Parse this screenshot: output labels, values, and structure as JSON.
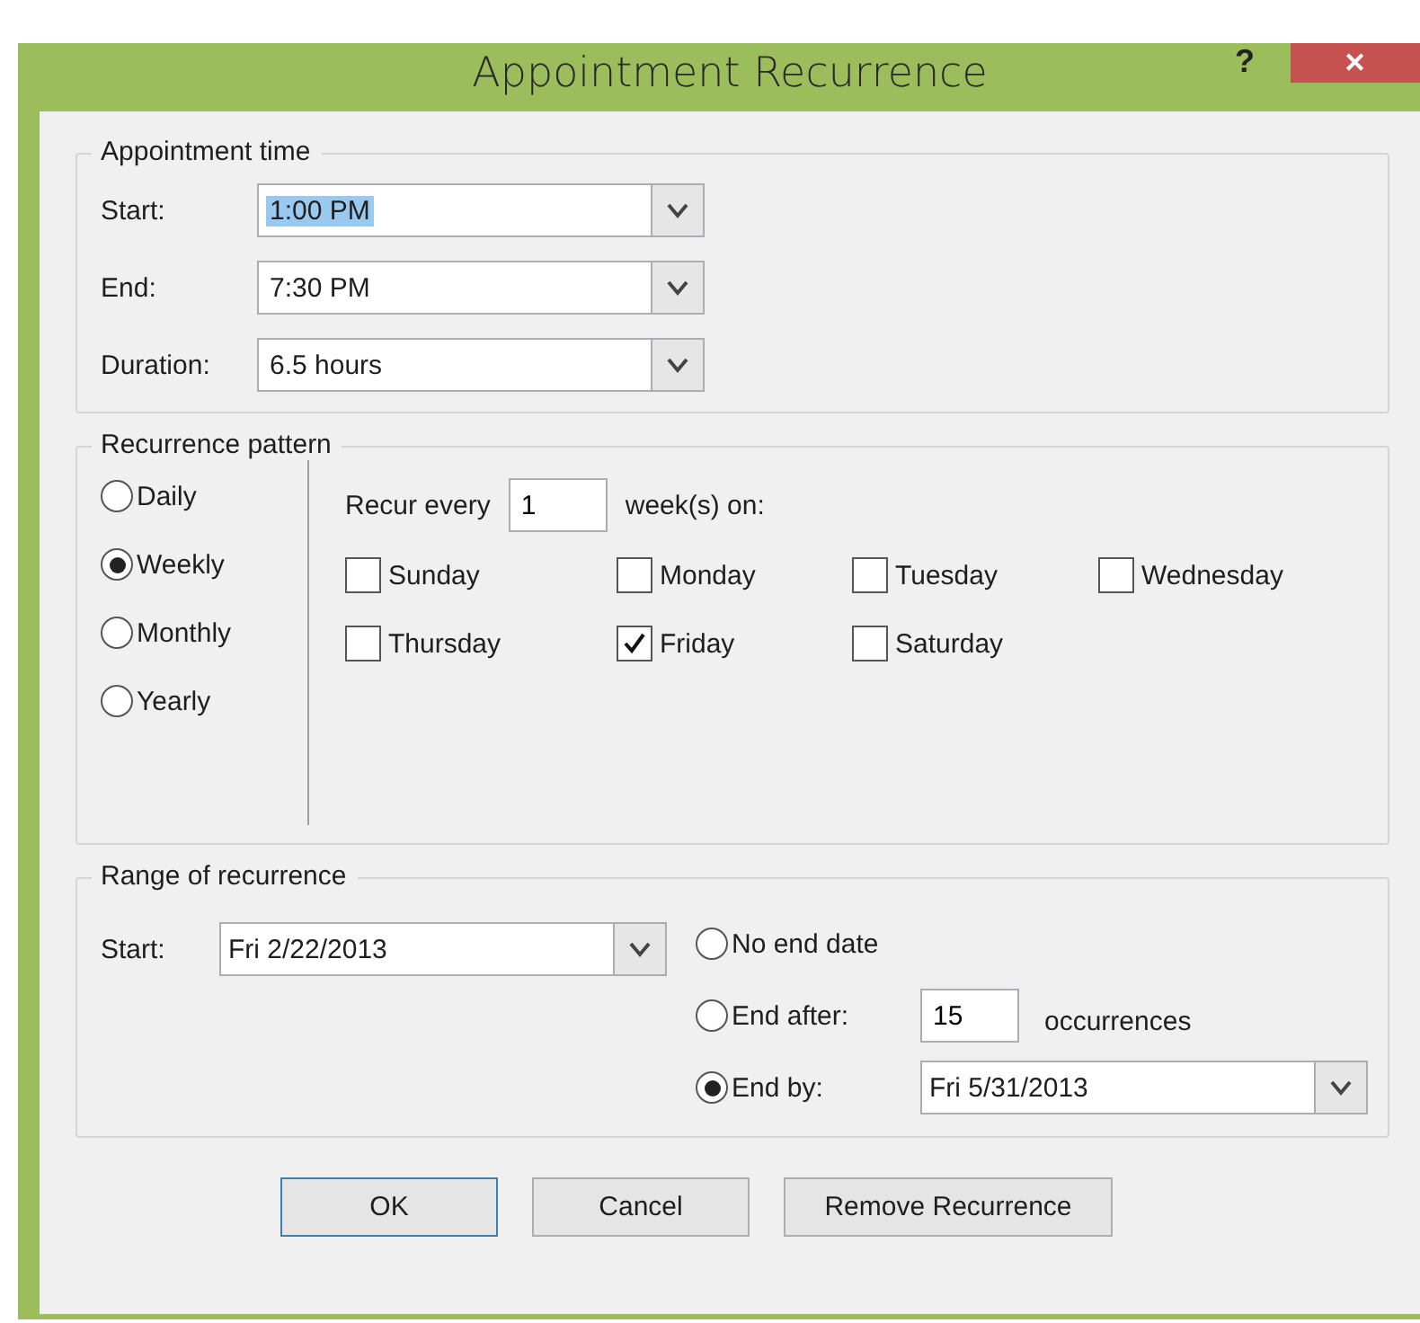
{
  "window": {
    "title": "Appointment Recurrence",
    "help": "?",
    "close": "✕"
  },
  "appointment_time": {
    "legend": "Appointment time",
    "fields": [
      {
        "label": "Start:",
        "value": "1:00 PM",
        "highlighted": true
      },
      {
        "label": "End:",
        "value": "7:30 PM",
        "highlighted": false
      },
      {
        "label": "Duration:",
        "value": "6.5 hours",
        "highlighted": false
      }
    ]
  },
  "recurrence_pattern": {
    "legend": "Recurrence pattern",
    "frequencies": [
      {
        "label": "Daily",
        "selected": false
      },
      {
        "label": "Weekly",
        "selected": true
      },
      {
        "label": "Monthly",
        "selected": false
      },
      {
        "label": "Yearly",
        "selected": false
      }
    ],
    "recur_every_label": "Recur every",
    "interval": "1",
    "unit_label": "week(s) on:",
    "days": [
      {
        "label": "Sunday",
        "checked": false
      },
      {
        "label": "Monday",
        "checked": false
      },
      {
        "label": "Tuesday",
        "checked": false
      },
      {
        "label": "Wednesday",
        "checked": false
      },
      {
        "label": "Thursday",
        "checked": false
      },
      {
        "label": "Friday",
        "checked": true
      },
      {
        "label": "Saturday",
        "checked": false
      }
    ]
  },
  "range_of_recurrence": {
    "legend": "Range of recurrence",
    "start_label": "Start:",
    "start_value": "Fri 2/22/2013",
    "end_options": [
      {
        "kind": "none",
        "label": "No end date",
        "selected": false
      },
      {
        "kind": "after",
        "label": "End after:",
        "value": "15",
        "suffix": "occurrences",
        "selected": false
      },
      {
        "kind": "by",
        "label": "End by:",
        "value": "Fri 5/31/2013",
        "selected": true
      }
    ]
  },
  "buttons": [
    {
      "label": "OK",
      "default": true
    },
    {
      "label": "Cancel",
      "default": false
    },
    {
      "label": "Remove Recurrence",
      "default": false
    }
  ]
}
